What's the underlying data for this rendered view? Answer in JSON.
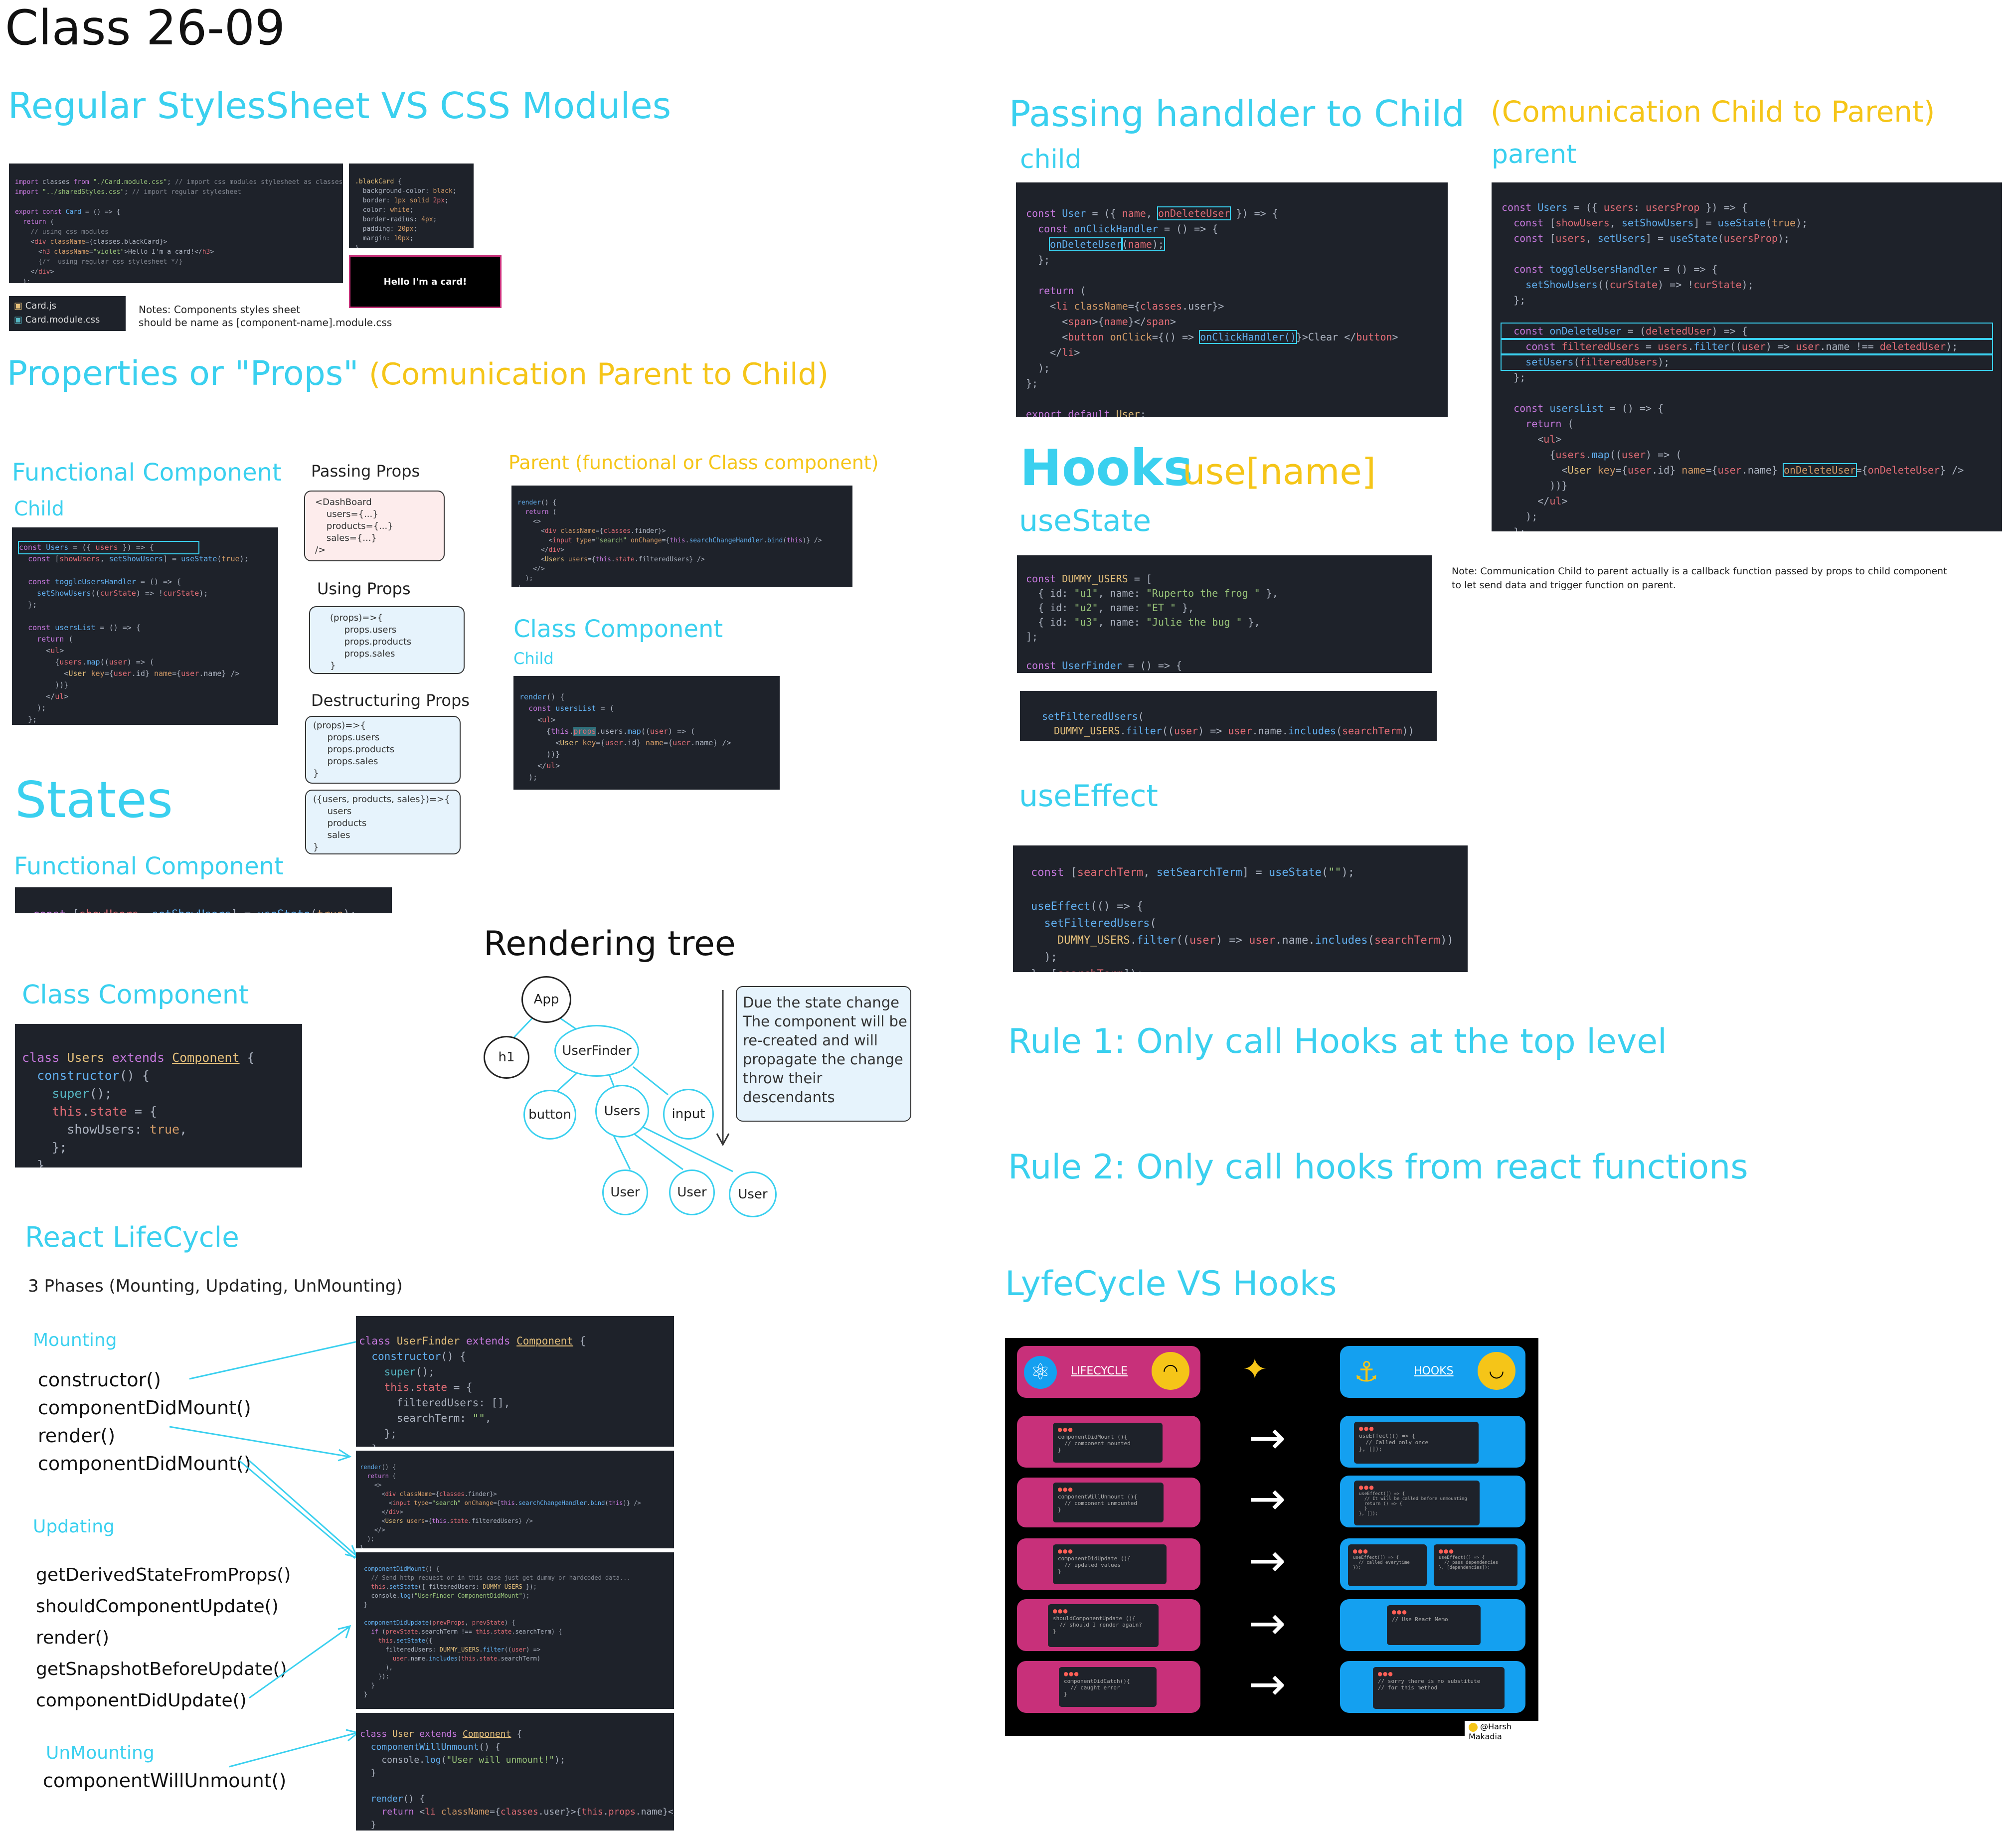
{
  "title": "Class 26-09",
  "sections": {
    "stylesheets": "Regular StylesSheet VS CSS Modules",
    "props": "Properties or \"Props\"",
    "props_sub": "(Comunication Parent to Child)",
    "functional_component": "Functional Component",
    "child": "Child",
    "passing_props": "Passing Props",
    "using_props": "Using Props",
    "destructuring_props": "Destructuring Props",
    "parent_heading": "Parent (functional or Class component)",
    "class_component": "Class Component",
    "class_child": "Child",
    "states": "States",
    "states_functional": "Functional Component",
    "states_class": "Class Component",
    "rendering_tree": "Rendering tree",
    "lifecycle": "React LifeCycle",
    "phases": "3 Phases (Mounting, Updating, UnMounting)",
    "mounting": "Mounting",
    "updating": "Updating",
    "unmounting": "UnMounting",
    "passing_handler": "Passing handlder to Child",
    "passing_handler_sub": "(Comunication Child to Parent)",
    "child_lower": "child",
    "parent_lower": "parent",
    "hooks": "Hooks",
    "hooks_sub": "use[name]",
    "use_state": "useState",
    "use_effect": "useEffect",
    "rule1": "Rule 1: Only call Hooks at the top level",
    "rule2": "Rule 2: Only call hooks from react functions",
    "lifecycle_vs_hooks": "LyfeCycle VS Hooks"
  },
  "notes": {
    "files": [
      "Card.js",
      "Card.module.css"
    ],
    "components_note": "Notes: Components styles sheet\nshould be name as [component-name].module.css",
    "hello_card": "Hello I'm a card!",
    "callback_note": "Note: Communication Child to parent actually is a callback function passed by props to child component\nto let send data and trigger function on parent.",
    "tree_note": "Due the state change\nThe component will be\nre-created and will\npropagate the change\nthrow their\ndescendants"
  },
  "props_boxes": {
    "passing": "<DashBoard\n    users={...}\n    products={...}\n    sales={...}\n/>",
    "using": "(props)=>{\n     props.users\n     props.products\n     props.sales\n}",
    "destructuring1": "(props)=>{\n     props.users\n     props.products\n     props.sales\n}",
    "destructuring2": "({users, products, sales})=>{\n     users\n     products\n     sales\n}"
  },
  "tree": {
    "app": "App",
    "h1": "h1",
    "userfinder": "UserFinder",
    "button": "button",
    "users": "Users",
    "input": "input",
    "user1": "User",
    "user2": "User",
    "user3": "User"
  },
  "lifecycle_methods": {
    "mounting": [
      "constructor()",
      "componentDidMount()",
      "render()",
      "componentDidMount()"
    ],
    "updating": [
      "getDerivedStateFromProps()",
      "shouldComponentUpdate()",
      "render()",
      "getSnapshotBeforeUpdate()",
      "componentDidUpdate()"
    ],
    "unmounting": [
      "componentWillUnmount()"
    ]
  },
  "lvh": {
    "lifecycle_label": "LIFECYCLE",
    "hooks_label": "HOOKS",
    "credit": "@Harsh Makadia",
    "left_cards": [
      "componentDidMount (){\n  // component mounted\n}",
      "componentWillUnmount (){\n  // component unmounted\n}",
      "componentDidUpdate (){\n  // updated values\n}",
      "shouldComponentUpdate (){\n  // should I render again?\n}",
      "componentDidCatch(){\n  // caught error\n}"
    ],
    "right_cards": [
      "useEffect(() => {\n  // Called only once\n}, []);",
      "useEffect(() => {\n  // It will be called before unmounting\n  return () => {\n  }\n}, []);",
      "useEffect(() => {\n  // called everytime\n});",
      "// Use React Memo",
      "// sorry there is no substitute\n// for this method"
    ],
    "right_extra": "useEffect(() => {\n  // pass dependencies\n}, [dependencies]);"
  },
  "colors": {
    "cyan": "#3ad0ef",
    "gold": "#f5c518",
    "pink": "#c8307a",
    "blue": "#14a0f0",
    "code_bg": "#1e222a"
  }
}
